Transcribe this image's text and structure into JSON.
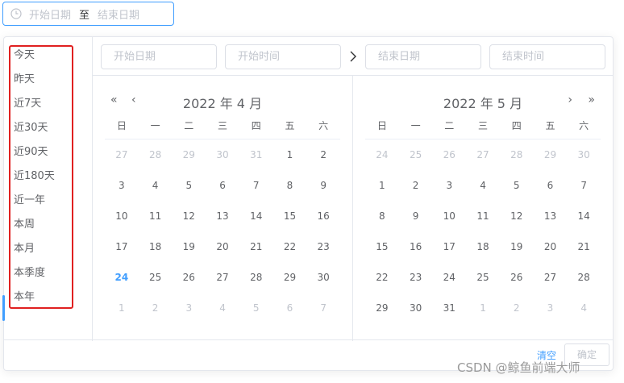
{
  "range_input": {
    "start_placeholder": "开始日期",
    "separator": "至",
    "end_placeholder": "结束日期"
  },
  "shortcuts": [
    "今天",
    "昨天",
    "近7天",
    "近30天",
    "近90天",
    "近180天",
    "近一年",
    "本周",
    "本月",
    "本季度",
    "本年"
  ],
  "editors": {
    "start_date": "开始日期",
    "start_time": "开始时间",
    "end_date": "结束日期",
    "end_time": "结束时间"
  },
  "weekdays": [
    "日",
    "一",
    "二",
    "三",
    "四",
    "五",
    "六"
  ],
  "left_calendar": {
    "title": "2022 年 4 月",
    "rows": [
      [
        {
          "d": "27",
          "m": 1
        },
        {
          "d": "28",
          "m": 1
        },
        {
          "d": "29",
          "m": 1
        },
        {
          "d": "30",
          "m": 1
        },
        {
          "d": "31",
          "m": 1
        },
        {
          "d": "1"
        },
        {
          "d": "2"
        }
      ],
      [
        {
          "d": "3"
        },
        {
          "d": "4"
        },
        {
          "d": "5"
        },
        {
          "d": "6"
        },
        {
          "d": "7"
        },
        {
          "d": "8"
        },
        {
          "d": "9"
        }
      ],
      [
        {
          "d": "10"
        },
        {
          "d": "11"
        },
        {
          "d": "12"
        },
        {
          "d": "13"
        },
        {
          "d": "14"
        },
        {
          "d": "15"
        },
        {
          "d": "16"
        }
      ],
      [
        {
          "d": "17"
        },
        {
          "d": "18"
        },
        {
          "d": "19"
        },
        {
          "d": "20"
        },
        {
          "d": "21"
        },
        {
          "d": "22"
        },
        {
          "d": "23"
        }
      ],
      [
        {
          "d": "24",
          "t": 1
        },
        {
          "d": "25"
        },
        {
          "d": "26"
        },
        {
          "d": "27"
        },
        {
          "d": "28"
        },
        {
          "d": "29"
        },
        {
          "d": "30"
        }
      ],
      [
        {
          "d": "1",
          "m": 1
        },
        {
          "d": "2",
          "m": 1
        },
        {
          "d": "3",
          "m": 1
        },
        {
          "d": "4",
          "m": 1
        },
        {
          "d": "5",
          "m": 1
        },
        {
          "d": "6",
          "m": 1
        },
        {
          "d": "7",
          "m": 1
        }
      ]
    ]
  },
  "right_calendar": {
    "title": "2022 年 5 月",
    "rows": [
      [
        {
          "d": "24",
          "m": 1
        },
        {
          "d": "25",
          "m": 1
        },
        {
          "d": "26",
          "m": 1
        },
        {
          "d": "27",
          "m": 1
        },
        {
          "d": "28",
          "m": 1
        },
        {
          "d": "29",
          "m": 1
        },
        {
          "d": "30",
          "m": 1
        }
      ],
      [
        {
          "d": "1"
        },
        {
          "d": "2"
        },
        {
          "d": "3"
        },
        {
          "d": "4"
        },
        {
          "d": "5"
        },
        {
          "d": "6"
        },
        {
          "d": "7"
        }
      ],
      [
        {
          "d": "8"
        },
        {
          "d": "9"
        },
        {
          "d": "10"
        },
        {
          "d": "11"
        },
        {
          "d": "12"
        },
        {
          "d": "13"
        },
        {
          "d": "14"
        }
      ],
      [
        {
          "d": "15"
        },
        {
          "d": "16"
        },
        {
          "d": "17"
        },
        {
          "d": "18"
        },
        {
          "d": "19"
        },
        {
          "d": "20"
        },
        {
          "d": "21"
        }
      ],
      [
        {
          "d": "22"
        },
        {
          "d": "23"
        },
        {
          "d": "24"
        },
        {
          "d": "25"
        },
        {
          "d": "26"
        },
        {
          "d": "27"
        },
        {
          "d": "28"
        }
      ],
      [
        {
          "d": "29"
        },
        {
          "d": "30"
        },
        {
          "d": "31"
        },
        {
          "d": "1",
          "m": 1
        },
        {
          "d": "2",
          "m": 1
        },
        {
          "d": "3",
          "m": 1
        },
        {
          "d": "4",
          "m": 1
        }
      ]
    ]
  },
  "footer": {
    "clear": "清空",
    "ok": "确定"
  },
  "watermark": "CSDN @鲸鱼前端大师",
  "colors": {
    "accent": "#409eff",
    "highlight_border": "#e02020"
  }
}
